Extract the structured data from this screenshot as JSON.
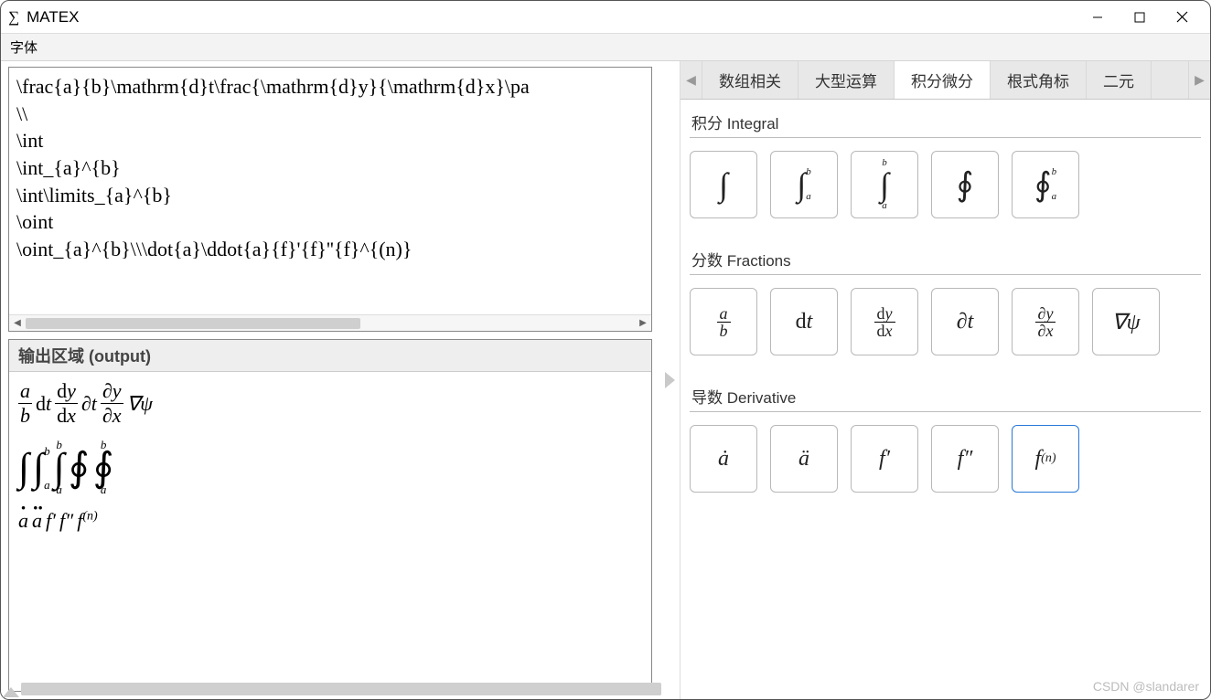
{
  "window": {
    "icon": "∑",
    "title": "MATEX"
  },
  "menu": {
    "font": "字体"
  },
  "input": {
    "text": "\\frac{a}{b}\\mathrm{d}t\\frac{\\mathrm{d}y}{\\mathrm{d}x}\\pa\n\\\\\n\\int\n\\int_{a}^{b}\n\\int\\limits_{a}^{b}\n\\oint\n\\oint_{a}^{b}\\\\\\dot{a}\\ddot{a}{f}'{f}''{f}^{(n)}"
  },
  "output": {
    "header": "输出区域 (output)"
  },
  "tabs": {
    "items": [
      "数组相关",
      "大型运算",
      "积分微分",
      "根式角标",
      "二元"
    ],
    "active_index": 2
  },
  "sections": {
    "integral": {
      "title": "积分 Integral"
    },
    "fractions": {
      "title": "分数 Fractions"
    },
    "derivative": {
      "title": "导数 Derivative"
    }
  },
  "buttons": {
    "integral": [
      {
        "name": "int",
        "display": "∫"
      },
      {
        "name": "int-ab-side",
        "display": "∫",
        "sub": "a",
        "sup": "b",
        "side": true
      },
      {
        "name": "int-ab-limits",
        "display": "∫",
        "sub": "a",
        "sup": "b",
        "side": false
      },
      {
        "name": "oint",
        "display": "∮"
      },
      {
        "name": "oint-ab",
        "display": "∮",
        "sub": "a",
        "sup": "b",
        "side": true
      }
    ],
    "fractions": [
      {
        "name": "frac-ab",
        "type": "frac",
        "num": "a",
        "den": "b"
      },
      {
        "name": "dt",
        "type": "text",
        "html": "<span class='upright'>d</span>t"
      },
      {
        "name": "dy-dx",
        "type": "frac",
        "num_html": "<span class='upright'>d</span>y",
        "den_html": "<span class='upright'>d</span>x"
      },
      {
        "name": "partial-t",
        "type": "text",
        "html": "∂t"
      },
      {
        "name": "partial-y-x",
        "type": "frac",
        "num_html": "∂y",
        "den_html": "∂x"
      },
      {
        "name": "nabla-psi",
        "type": "text",
        "html": "∇ψ"
      }
    ],
    "derivative": [
      {
        "name": "a-dot",
        "html": "ȧ"
      },
      {
        "name": "a-ddot",
        "html": "ä"
      },
      {
        "name": "f-prime",
        "html": "f′"
      },
      {
        "name": "f-pprime",
        "html": "f″"
      },
      {
        "name": "f-n",
        "html": "f<span style='font-size:14px;vertical-align:super'>(n)</span>",
        "selected": true
      }
    ]
  },
  "watermark": "CSDN @slandarer"
}
